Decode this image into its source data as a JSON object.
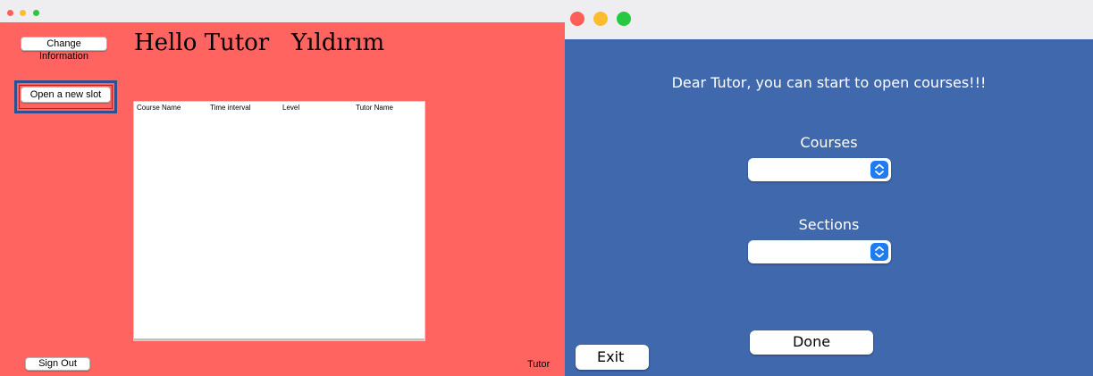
{
  "left_window": {
    "controls": {
      "close_color": "#ff5f57",
      "minimize_color": "#febc2e",
      "zoom_color": "#28c840"
    },
    "background_color": "#ff6461",
    "change_information_label": "Change Information",
    "greeting": "Hello Tutor   Yıldırım",
    "open_slot_label": "Open a new slot",
    "table": {
      "columns": [
        "Course Name",
        "Time interval",
        "Level",
        "Tutor Name"
      ],
      "rows": []
    },
    "sign_out_label": "Sign Out",
    "role_label": "Tutor"
  },
  "right_window": {
    "controls": {
      "close_color": "#ff5f57",
      "minimize_color": "#febc2e",
      "zoom_color": "#28c840"
    },
    "background_color": "#4068ad",
    "message": "Dear Tutor, you can start to open courses!!!",
    "courses": {
      "label": "Courses",
      "selected": ""
    },
    "sections": {
      "label": "Sections",
      "selected": ""
    },
    "done_label": "Done",
    "exit_label": "Exit"
  }
}
